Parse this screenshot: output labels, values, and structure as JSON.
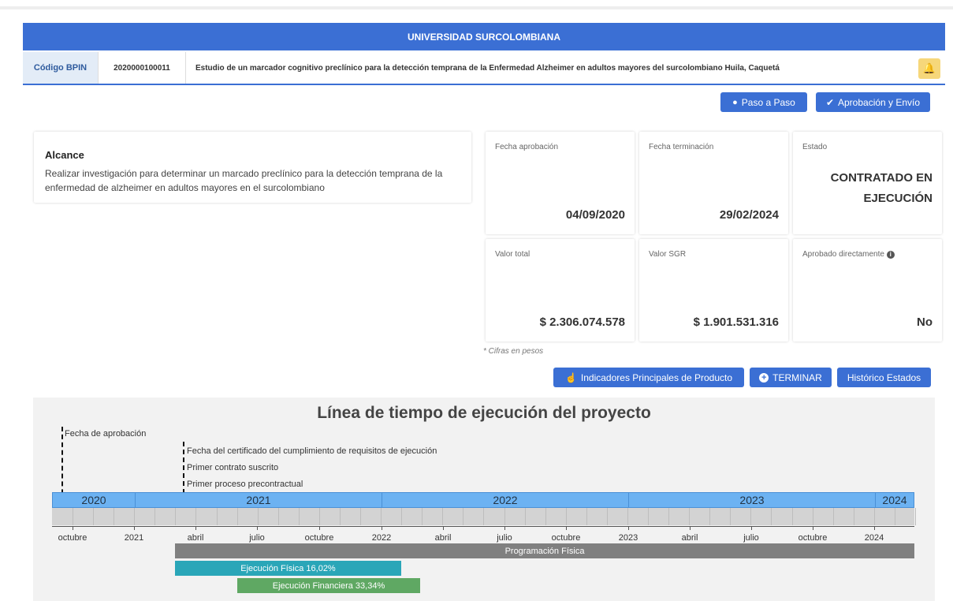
{
  "banner": {
    "title": "UNIVERSIDAD SURCOLOMBIANA"
  },
  "project": {
    "bpin_label": "Código BPIN",
    "bpin_code": "2020000100011",
    "title": "Estudio de un marcador cognitivo preclínico para la detección temprana de la Enfermedad Alzheimer en adultos mayores del surcolombiano Huila, Caquetá"
  },
  "actions": {
    "paso_a_paso": "Paso a Paso",
    "aprobacion": "Aprobación y Envío",
    "indicadores": "Indicadores Principales de Producto",
    "terminar": "TERMINAR",
    "historico": "Histórico Estados"
  },
  "alcance": {
    "title": "Alcance",
    "text": "Realizar investigación para determinar un marcado preclínico para la detección temprana de la enfermedad de alzheimer en adultos mayores en el surcolombiano"
  },
  "cards": {
    "fecha_aprobacion": {
      "label": "Fecha aprobación",
      "value": "04/09/2020"
    },
    "fecha_terminacion": {
      "label": "Fecha terminación",
      "value": "29/02/2024"
    },
    "estado": {
      "label": "Estado",
      "value": "CONTRATADO EN EJECUCIÓN"
    },
    "valor_total": {
      "label": "Valor total",
      "value": "$ 2.306.074.578"
    },
    "valor_sgr": {
      "label": "Valor SGR",
      "value": "$ 1.901.531.316"
    },
    "aprobado_directamente": {
      "label": "Aprobado directamente",
      "value": "No"
    }
  },
  "cifras_note": "* Cifras en pesos",
  "timeline": {
    "title": "Línea de tiempo de ejecución del proyecto",
    "markers": [
      {
        "label": "Fecha de aprobación"
      },
      {
        "label": "Fecha del certificado del cumplimiento de requisitos de ejecución"
      },
      {
        "label": "Primer contrato suscrito"
      },
      {
        "label": "Primer proceso precontractual"
      }
    ],
    "years": [
      "2020",
      "2021",
      "2022",
      "2023",
      "2024"
    ],
    "axis_labels": [
      "octubre",
      "2021",
      "abril",
      "julio",
      "octubre",
      "2022",
      "abril",
      "julio",
      "octubre",
      "2023",
      "abril",
      "julio",
      "octubre",
      "2024"
    ],
    "bars": [
      {
        "label": "Programación Física",
        "color": "#808080"
      },
      {
        "label": "Ejecución Física 16,02%",
        "color": "#2aa6b8"
      },
      {
        "label": "Ejecución Financiera 33,34%",
        "color": "#5fa863"
      }
    ]
  },
  "colors": {
    "primary": "#3b6fd4",
    "warning": "#f6d77a"
  }
}
